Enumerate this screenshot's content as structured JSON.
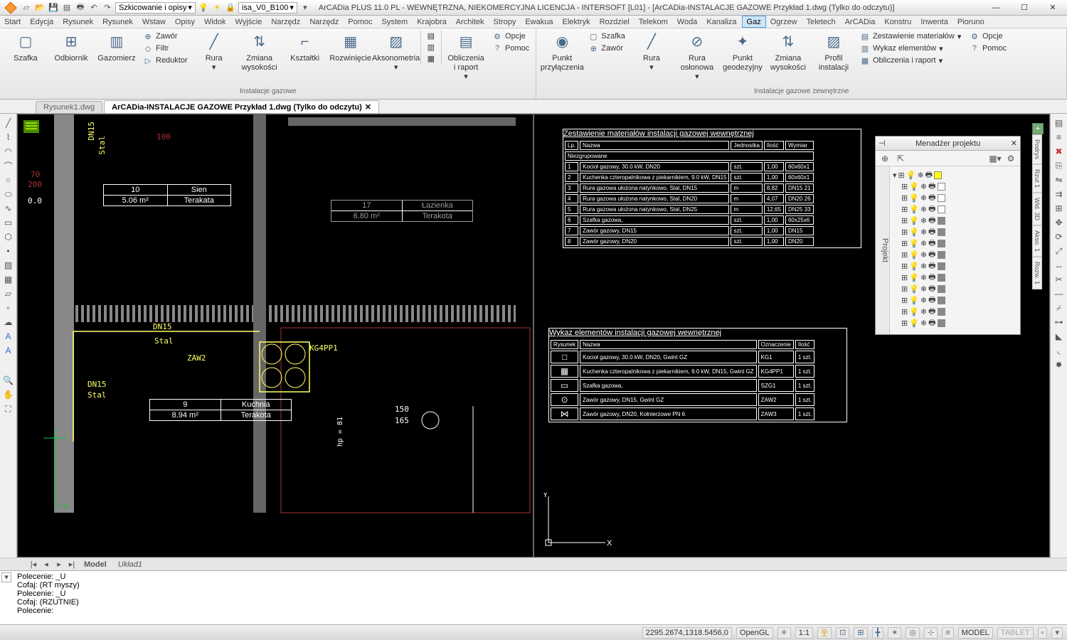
{
  "title": "ArCADia PLUS 11.0 PL - WEWNĘTRZNA, NIEKOMERCYJNA LICENCJA - INTERSOFT [L01] - [ArCADia-INSTALACJE GAZOWE Przykład 1.dwg (Tylko do odczytu)]",
  "quick_combo1": "Szkicowanie i opisy",
  "quick_combo2": "isa_V0_B100",
  "menus": [
    "Start",
    "Edycja",
    "Rysunek",
    "Rysunek",
    "Wstaw",
    "Opisy",
    "Widok",
    "Wyjście",
    "Narzędz",
    "Narzędz",
    "Pomoc",
    "System",
    "Krajobra",
    "Architek",
    "Stropy",
    "Ewakua",
    "Elektryk",
    "Rozdziel",
    "Telekom",
    "Woda",
    "Kanaliza",
    "Gaz",
    "Ogrzew",
    "Teletech",
    "ArCADia",
    "Konstru",
    "Inwenta",
    "Pioruno"
  ],
  "active_menu": "Gaz",
  "ribbon": {
    "group1_title": "Instalacje gazowe",
    "group2_title": "Instalacje gazowe zewnętrzne",
    "big": {
      "szafka": "Szafka",
      "odbiornik": "Odbiornik",
      "gazomierz": "Gazomierz",
      "rura": "Rura",
      "zmiana_w": "Zmiana\nwysokości",
      "ksztaltki": "Kształtki",
      "rozwiniecie": "Rozwinięcie",
      "aksonometria": "Aksonometria",
      "obliczenia": "Obliczenia\ni raport",
      "punkt_przyl": "Punkt\nprzyłączenia",
      "rura2": "Rura",
      "rura_osl": "Rura\nosłonowa",
      "punkt_geo": "Punkt\ngeodezyjny",
      "zmiana_w2": "Zmiana\nwysokości",
      "profil": "Profil\ninstalacji"
    },
    "mini": {
      "zawor": "Zawór",
      "filtr": "Filtr",
      "reduktor": "Reduktor",
      "opcje": "Opcje",
      "pomoc": "Pomoc",
      "szafka2": "Szafka",
      "zawor2": "Zawór",
      "zest_mat": "Zestawienie materiałów",
      "wykaz_el": "Wykaz elementów",
      "oblicz_rap": "Obliczenia i raport",
      "opcje2": "Opcje",
      "pomoc2": "Pomoc"
    }
  },
  "file_tabs": {
    "t1": "Rysunek1.dwg",
    "t2": "ArCADia-INSTALACJE GAZOWE Przykład 1.dwg (Tylko do odczytu)"
  },
  "layout_tabs": {
    "model": "Model",
    "u1": "Układ1"
  },
  "pm": {
    "title": "Menadżer projektu",
    "side": "Projekt",
    "side_tabs": [
      "Podrys",
      "Rzut 1",
      "Wid. 3D",
      "Akso. 1",
      "Rozw. 1"
    ]
  },
  "cmd_lines": [
    "Polecenie: _U",
    "Cofaj: (RT myszy)",
    "Polecenie: _U",
    "Cofaj: (RZUTNIE)",
    "Polecenie:"
  ],
  "status": {
    "coords": "2295.2674,1318.5456,0",
    "render": "OpenGL",
    "scale": "1:1",
    "model": "MODEL",
    "tablet": "TABLET"
  },
  "drawing": {
    "dn15_1": "DN15",
    "stal_1": "Stal",
    "stal_v": "Stal",
    "dim100": "100",
    "dim70": "70",
    "dim200": "200",
    "dim0": "0.0",
    "dn15_2": "DN15",
    "stal_2": "Stal",
    "zaw2": "ZAW2",
    "kg4": "KG4PP1",
    "hp_81": "hp = 81",
    "dim150": "150",
    "dim165": "165",
    "room10": {
      "n": "10",
      "nm": "Sien",
      "a": "5.06 m²",
      "f": "Terakata"
    },
    "room17": {
      "n": "17",
      "nm": "Łazienka",
      "a": "6.80 m²",
      "f": "Terakota"
    },
    "room9": {
      "n": "9",
      "nm": "Kuchnia",
      "a": "8.94 m²",
      "f": "Terakota"
    }
  },
  "schedule1": {
    "title": "Zestawienie materiałów instalacji gazowej wewnętrznej",
    "h": [
      "Lp.",
      "Nazwa",
      "Jednostka",
      "Ilość",
      "Wymiar"
    ],
    "grp": "Niezgrupowane",
    "rows": [
      [
        "1",
        "Kocioł gazowy, 30.0 kW, DN20",
        "szt.",
        "1,00",
        "60x60x1"
      ],
      [
        "2",
        "Kuchenka czteropalnikowa z piekarnikiem, 9.0 kW, DN15",
        "szt.",
        "1,00",
        "60x60x1"
      ],
      [
        "3",
        "Rura gazowa ułożona natynkowo, Stal, DN15",
        "m",
        "8,82",
        "DN15 21"
      ],
      [
        "4",
        "Rura gazowa ułożona natynkowo, Stal, DN20",
        "m",
        "4,07",
        "DN20 26"
      ],
      [
        "5",
        "Rura gazowa ułożona natynkowo, Stal, DN25",
        "m",
        "12,65",
        "DN25 33"
      ],
      [
        "6",
        "Szafka gazowa,",
        "szt.",
        "1,00",
        "60x25x6"
      ],
      [
        "7",
        "Zawór gazowy, DN15",
        "szt.",
        "1,00",
        "DN15"
      ],
      [
        "8",
        "Zawór gazowy, DN20",
        "szt.",
        "1,00",
        "DN20"
      ]
    ]
  },
  "schedule2": {
    "title": "Wykaz elementów instalacji gazowej wewnętrznej",
    "h": [
      "Rysunek",
      "Nazwa",
      "Oznaczenie",
      "Ilość"
    ],
    "rows": [
      [
        "□",
        "Kocioł gazowy, 30.0 kW, DN20,\nGwint GZ",
        "KG1",
        "1 szt."
      ],
      [
        "▦",
        "Kuchenka czteropalnikowa z piekarnikiem, 9.0 kW, DN15,\nGwint GZ",
        "KG4PP1",
        "1 szt."
      ],
      [
        "▭",
        "Szafka gazowa,",
        "SZG1",
        "1 szt."
      ],
      [
        "⊙",
        "Zawór gazowy, DN15,\nGwint GZ",
        "ZAW2",
        "1 szt."
      ],
      [
        "⋈",
        "Zawór gazowy, DN20,\nKołnierzowe PN 6",
        "ZAW3",
        "1 szt."
      ]
    ]
  }
}
